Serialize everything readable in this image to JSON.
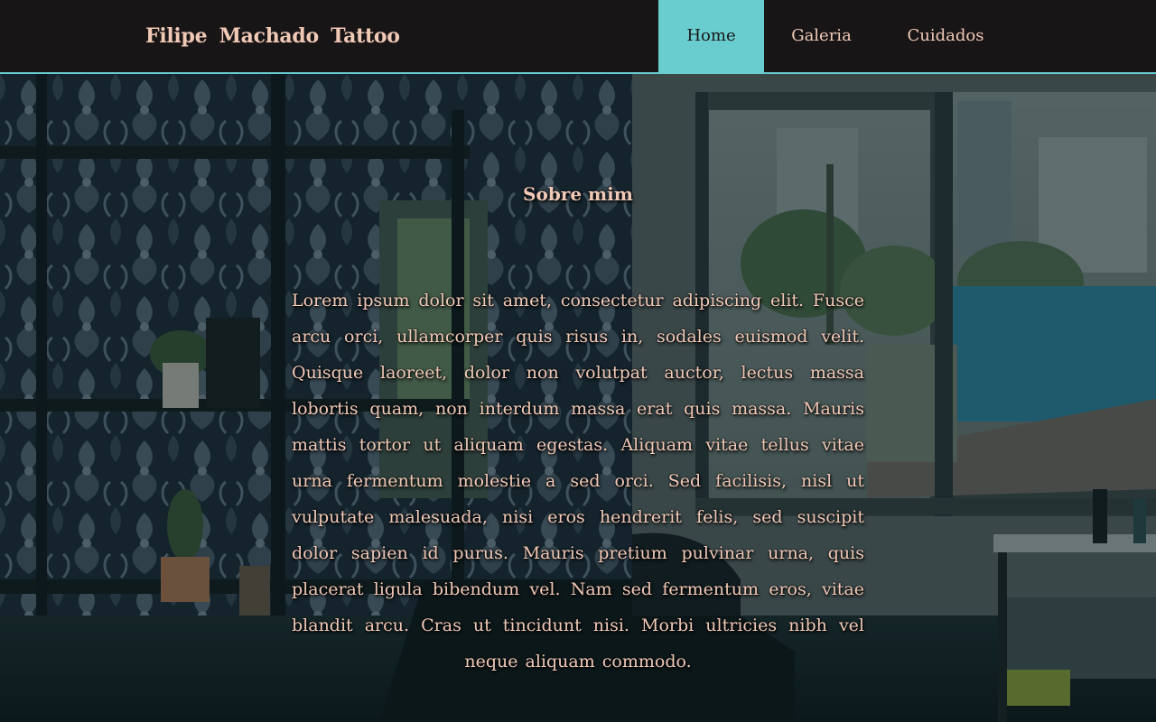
{
  "header": {
    "brand": "Filipe Machado Tattoo",
    "nav": [
      {
        "label": "Home",
        "active": true
      },
      {
        "label": "Galeria",
        "active": false
      },
      {
        "label": "Cuidados",
        "active": false
      }
    ]
  },
  "about": {
    "title": "Sobre mim",
    "text": "Lorem ipsum dolor sit amet, consectetur adipiscing elit. Fusce arcu orci, ullamcorper quis risus in, sodales euismod velit. Quisque laoreet, dolor non volutpat auctor, lectus massa lobortis quam, non interdum massa erat quis massa. Mauris mattis tortor ut aliquam egestas. Aliquam vitae tellus vitae urna fermentum molestie a sed orci. Sed facilisis, nisl ut vulputate malesuada, nisi eros hendrerit felis, sed suscipit dolor sapien id purus. Mauris pretium pulvinar urna, quis placerat ligula bibendum vel. Nam sed fermentum eros, vitae blandit arcu. Cras ut tincidunt nisi. Morbi ultricies nibh vel neque aliquam commodo."
  },
  "colors": {
    "header_bg": "#181516",
    "accent": "#69cdd0",
    "text": "#f1c9b7"
  }
}
